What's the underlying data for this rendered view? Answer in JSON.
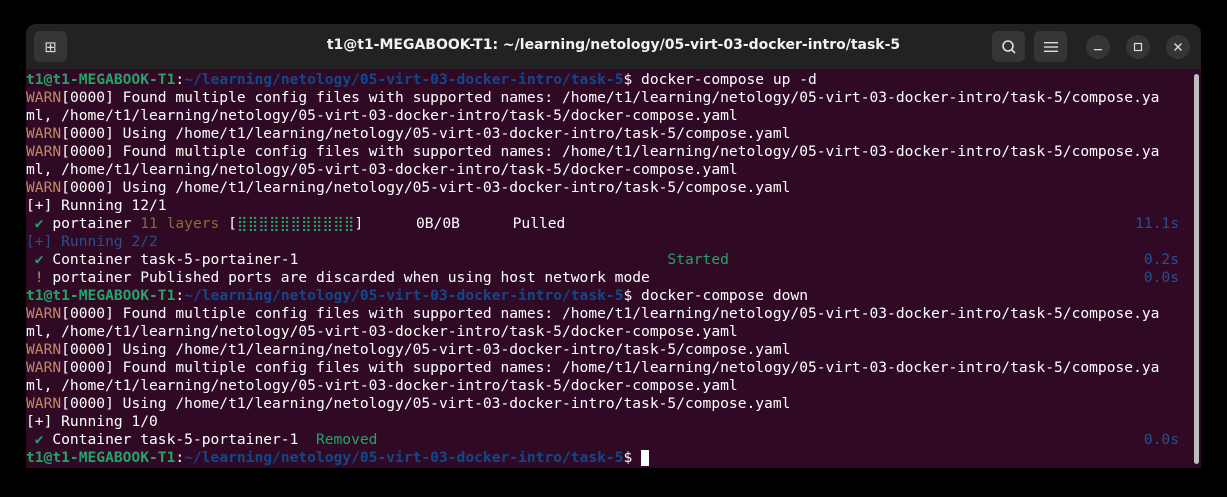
{
  "window": {
    "title": "t1@t1-MEGABOOK-T1: ~/learning/netology/05-virt-03-docker-intro/task-5"
  },
  "icons": {
    "new_tab": "new-tab-icon",
    "search": "search-icon",
    "menu": "hamburger-menu-icon",
    "minimize": "minimize-icon",
    "maximize": "maximize-icon",
    "close": "close-icon"
  },
  "colors": {
    "background": "#300a24",
    "prompt_user": "#26a269",
    "prompt_path": "#12488b",
    "warn": "#c5866a",
    "dim": "#2a4f8f"
  },
  "terminal": {
    "lines": [
      {
        "segs": [
          {
            "t": "t1@t1-MEGABOOK-T1",
            "c": "green"
          },
          {
            "t": ":",
            "c": ""
          },
          {
            "t": "~/learning/netology/05-virt-03-docker-intro/task-5",
            "c": "path"
          },
          {
            "t": "$ docker-compose up -d",
            "c": ""
          }
        ]
      },
      {
        "segs": [
          {
            "t": "WARN",
            "c": "warn"
          },
          {
            "t": "[0000] Found multiple config files with supported names: /home/t1/learning/netology/05-virt-03-docker-intro/task-5/compose.ya",
            "c": ""
          }
        ]
      },
      {
        "segs": [
          {
            "t": "ml, /home/t1/learning/netology/05-virt-03-docker-intro/task-5/docker-compose.yaml",
            "c": ""
          }
        ]
      },
      {
        "segs": [
          {
            "t": "WARN",
            "c": "warn"
          },
          {
            "t": "[0000] Using /home/t1/learning/netology/05-virt-03-docker-intro/task-5/compose.yaml",
            "c": ""
          }
        ]
      },
      {
        "segs": [
          {
            "t": "WARN",
            "c": "warn"
          },
          {
            "t": "[0000] Found multiple config files with supported names: /home/t1/learning/netology/05-virt-03-docker-intro/task-5/compose.ya",
            "c": ""
          }
        ]
      },
      {
        "segs": [
          {
            "t": "ml, /home/t1/learning/netology/05-virt-03-docker-intro/task-5/docker-compose.yaml",
            "c": ""
          }
        ]
      },
      {
        "segs": [
          {
            "t": "WARN",
            "c": "warn"
          },
          {
            "t": "[0000] Using /home/t1/learning/netology/05-virt-03-docker-intro/task-5/compose.yaml",
            "c": ""
          }
        ]
      },
      {
        "segs": [
          {
            "t": "[+] Running 12/1",
            "c": ""
          }
        ]
      },
      {
        "segs": [
          {
            "t": " ✔",
            "c": "ok"
          },
          {
            "t": " portainer ",
            "c": ""
          },
          {
            "t": "11 layers",
            "c": "brown"
          },
          {
            "t": " [",
            "c": ""
          },
          {
            "t": "⣿⣿⣿⣿⣿⣿⣿⣿⣿⣿⣿",
            "c": "bar"
          },
          {
            "t": "]      0B/0B      Pulled",
            "c": ""
          }
        ],
        "time": "11.1s"
      },
      {
        "segs": [
          {
            "t": "[+] Running 2/2",
            "c": "dim"
          }
        ]
      },
      {
        "segs": [
          {
            "t": " ✔",
            "c": "ok"
          },
          {
            "t": " Container task-5-portainer-1                                          ",
            "c": ""
          },
          {
            "t": "Started",
            "c": "ok"
          }
        ],
        "time": "0.2s"
      },
      {
        "segs": [
          {
            "t": " !",
            "c": "bang"
          },
          {
            "t": " portainer Published ports are discarded when using host network mode",
            "c": ""
          }
        ],
        "time": "0.0s"
      },
      {
        "segs": [
          {
            "t": "t1@t1-MEGABOOK-T1",
            "c": "green"
          },
          {
            "t": ":",
            "c": ""
          },
          {
            "t": "~/learning/netology/05-virt-03-docker-intro/task-5",
            "c": "path"
          },
          {
            "t": "$ docker-compose down",
            "c": ""
          }
        ]
      },
      {
        "segs": [
          {
            "t": "WARN",
            "c": "warn"
          },
          {
            "t": "[0000] Found multiple config files with supported names: /home/t1/learning/netology/05-virt-03-docker-intro/task-5/compose.ya",
            "c": ""
          }
        ]
      },
      {
        "segs": [
          {
            "t": "ml, /home/t1/learning/netology/05-virt-03-docker-intro/task-5/docker-compose.yaml",
            "c": ""
          }
        ]
      },
      {
        "segs": [
          {
            "t": "WARN",
            "c": "warn"
          },
          {
            "t": "[0000] Using /home/t1/learning/netology/05-virt-03-docker-intro/task-5/compose.yaml",
            "c": ""
          }
        ]
      },
      {
        "segs": [
          {
            "t": "WARN",
            "c": "warn"
          },
          {
            "t": "[0000] Found multiple config files with supported names: /home/t1/learning/netology/05-virt-03-docker-intro/task-5/compose.ya",
            "c": ""
          }
        ]
      },
      {
        "segs": [
          {
            "t": "ml, /home/t1/learning/netology/05-virt-03-docker-intro/task-5/docker-compose.yaml",
            "c": ""
          }
        ]
      },
      {
        "segs": [
          {
            "t": "WARN",
            "c": "warn"
          },
          {
            "t": "[0000] Using /home/t1/learning/netology/05-virt-03-docker-intro/task-5/compose.yaml",
            "c": ""
          }
        ]
      },
      {
        "segs": [
          {
            "t": "[+] Running 1/0",
            "c": ""
          }
        ]
      },
      {
        "segs": [
          {
            "t": " ✔",
            "c": "ok"
          },
          {
            "t": " Container task-5-portainer-1  ",
            "c": ""
          },
          {
            "t": "Removed",
            "c": "ok"
          }
        ],
        "time": "0.0s"
      },
      {
        "segs": [
          {
            "t": "t1@t1-MEGABOOK-T1",
            "c": "green"
          },
          {
            "t": ":",
            "c": ""
          },
          {
            "t": "~/learning/netology/05-virt-03-docker-intro/task-5",
            "c": "path"
          },
          {
            "t": "$ ",
            "c": ""
          }
        ],
        "cursor": true
      }
    ]
  }
}
